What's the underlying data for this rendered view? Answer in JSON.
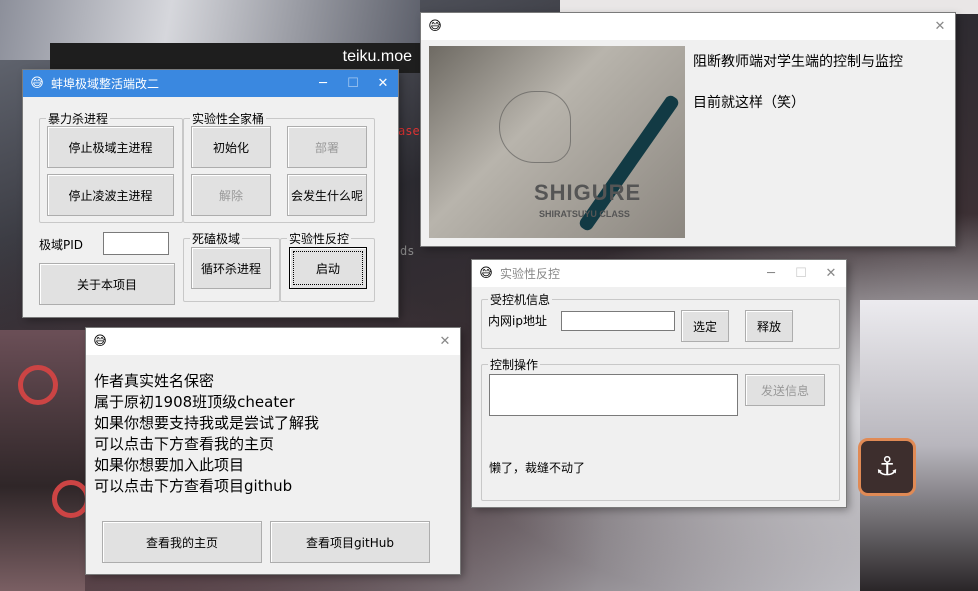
{
  "desktop": {
    "site_text": "teiku.moe",
    "bg_code_1": "ase",
    "bg_code_2": "ds"
  },
  "main_window": {
    "title": "蚌埠极域整活端改二",
    "controls": {
      "min": "─",
      "max": "☐",
      "close": "✕"
    },
    "group_kill": {
      "label": "暴力杀进程",
      "btn_stop_mythware": "停止极域主进程",
      "btn_stop_lingbo": "停止凌波主进程"
    },
    "group_experimental": {
      "label": "实验性全家桶",
      "btn_init": "初始化",
      "btn_deploy": "部署",
      "btn_release": "解除",
      "btn_what": "会发生什么呢"
    },
    "pid_label": "极域PID",
    "pid_value": "",
    "group_deadlock": {
      "label": "死磕极域",
      "btn_loop_kill": "循环杀进程"
    },
    "group_counter": {
      "label": "实验性反控",
      "btn_start": "启动"
    },
    "btn_about": "关于本项目"
  },
  "image_window": {
    "title": "",
    "line1": "阻断教师端对学生端的控制与监控",
    "line2": "目前就这样（笑）",
    "photo_text_main": "SHIGURE",
    "photo_text_sub": "SHIRATSUYU CLASS"
  },
  "about_window": {
    "title": "",
    "lines": [
      "作者真实姓名保密",
      "属于原初1908班顶级cheater",
      "如果你想要支持我或是尝试了解我",
      "可以点击下方查看我的主页",
      "如果你想要加入此项目",
      "可以点击下方查看项目github"
    ],
    "btn_homepage": "查看我的主页",
    "btn_github": "查看项目gitHub"
  },
  "counter_window": {
    "title": "实验性反控",
    "group_target": {
      "label": "受控机信息",
      "ip_label": "内网ip地址",
      "ip_value": "",
      "btn_select": "选定",
      "btn_release": "释放"
    },
    "group_control": {
      "label": "控制操作",
      "message_value": "",
      "btn_send": "发送信息",
      "status_text": "懒了，裁缝不动了"
    }
  },
  "icons": {
    "window_icon": "grinning-face-emoji",
    "anchor": "anchor-icon"
  },
  "colors": {
    "active_title": "#3a88e0",
    "window_bg": "#f0f0f0",
    "button_bg": "#e1e1e1"
  }
}
